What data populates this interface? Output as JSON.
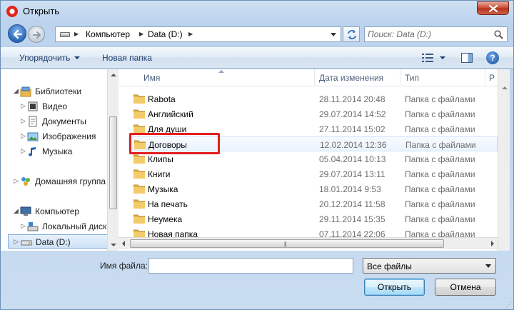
{
  "window": {
    "title": "Открыть"
  },
  "address": {
    "crumbs": [
      "Компьютер",
      "Data (D:)"
    ]
  },
  "search": {
    "placeholder": "Поиск: Data (D:)"
  },
  "toolbar": {
    "organize_label": "Упорядочить",
    "new_folder_label": "Новая папка"
  },
  "nav_pane": {
    "items": [
      {
        "label": "Библиотеки",
        "icon": "libraries-icon"
      },
      {
        "label": "Видео",
        "icon": "video-library-icon"
      },
      {
        "label": "Документы",
        "icon": "documents-library-icon"
      },
      {
        "label": "Изображения",
        "icon": "pictures-library-icon"
      },
      {
        "label": "Музыка",
        "icon": "music-library-icon"
      },
      {
        "label": "Домашняя группа",
        "icon": "homegroup-icon"
      },
      {
        "label": "Компьютер",
        "icon": "computer-icon"
      },
      {
        "label": "Локальный диск",
        "icon": "local-disk-icon"
      },
      {
        "label": "Data (D:)",
        "icon": "drive-icon",
        "selected": true
      }
    ]
  },
  "file_list": {
    "columns": [
      "Имя",
      "Дата изменения",
      "Тип",
      "Р"
    ],
    "rows": [
      {
        "name": "Rabota",
        "date": "28.11.2014 20:48",
        "type": "Папка с файлами"
      },
      {
        "name": "Английский",
        "date": "29.07.2014 14:52",
        "type": "Папка с файлами"
      },
      {
        "name": "Для души",
        "date": "27.11.2014 15:02",
        "type": "Папка с файлами"
      },
      {
        "name": "Договоры",
        "date": "12.02.2014 12:36",
        "type": "Папка с файлами",
        "hovered": true
      },
      {
        "name": "Клипы",
        "date": "05.04.2014 10:13",
        "type": "Папка с файлами"
      },
      {
        "name": "Книги",
        "date": "29.07.2014 13:11",
        "type": "Папка с файлами"
      },
      {
        "name": "Музыка",
        "date": "18.01.2014 9:53",
        "type": "Папка с файлами"
      },
      {
        "name": "На печать",
        "date": "20.12.2014 11:58",
        "type": "Папка с файлами"
      },
      {
        "name": "Неумека",
        "date": "29.11.2014 15:35",
        "type": "Папка с файлами"
      },
      {
        "name": "Новая папка",
        "date": "07.11.2014 22:06",
        "type": "Папка с файлами"
      }
    ]
  },
  "bottom": {
    "filename_label": "Имя файла:",
    "filename_value": "",
    "filter_value": "Все файлы",
    "open_label": "Открыть",
    "cancel_label": "Отмена"
  },
  "colors": {
    "highlight": "#e41e1e",
    "folder": "#e8b84a",
    "link_text": "#1e3d6b"
  }
}
